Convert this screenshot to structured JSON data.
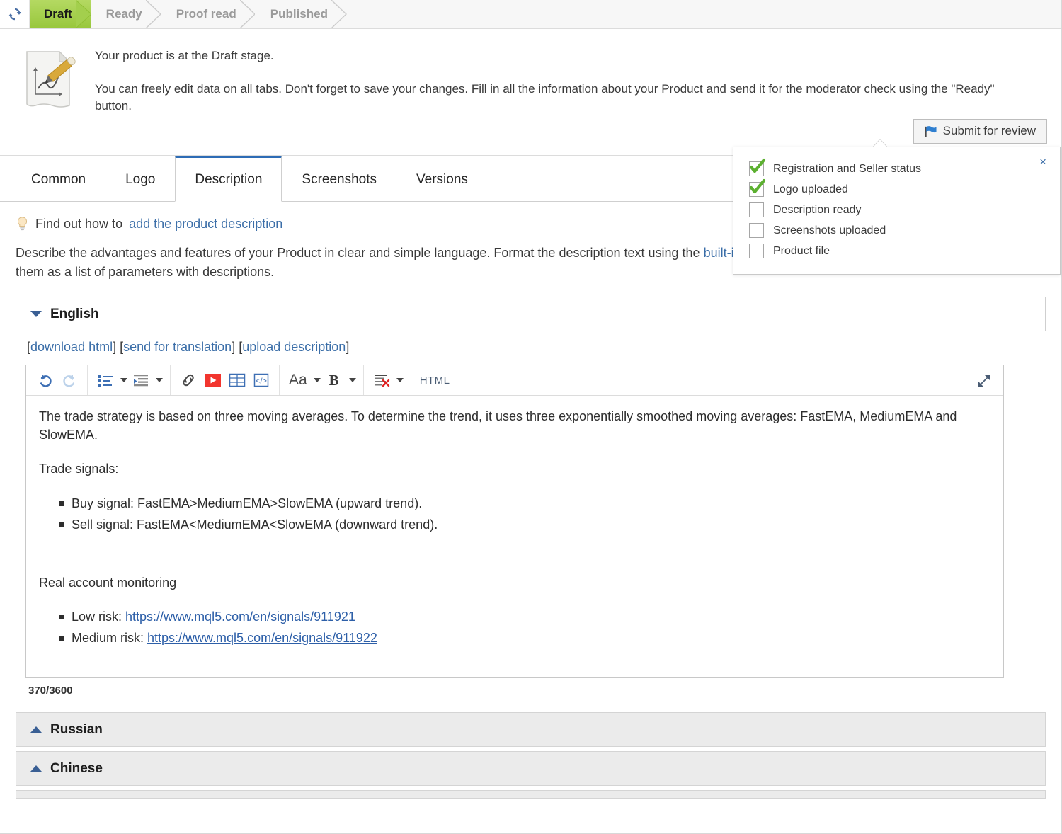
{
  "statusbar": {
    "refresh_icon": "refresh-icon",
    "steps": [
      {
        "label": "Draft",
        "active": true
      },
      {
        "label": "Ready",
        "active": false
      },
      {
        "label": "Proof read",
        "active": false
      },
      {
        "label": "Published",
        "active": false
      }
    ]
  },
  "notice": {
    "icon": "document-pencil-icon",
    "line1": "Your product is at the Draft stage.",
    "line2": "You can freely edit data on all tabs. Don't forget to save your changes. Fill in all the information about your Product and send it for the moderator check using the \"Ready\" button.",
    "submit_label": "Submit for review",
    "submit_icon": "flag-icon"
  },
  "checklist": {
    "close_label": "×",
    "items": [
      {
        "label": "Registration and Seller status",
        "checked": true
      },
      {
        "label": "Logo uploaded",
        "checked": true
      },
      {
        "label": "Description ready",
        "checked": false
      },
      {
        "label": "Screenshots uploaded",
        "checked": false
      },
      {
        "label": "Product file",
        "checked": false
      }
    ]
  },
  "tabs": [
    {
      "label": "Common",
      "active": false
    },
    {
      "label": "Logo",
      "active": false
    },
    {
      "label": "Description",
      "active": true
    },
    {
      "label": "Screenshots",
      "active": false
    },
    {
      "label": "Versions",
      "active": false
    }
  ],
  "content": {
    "hint_icon": "lightbulb-icon",
    "hint_prefix": "Find out how to",
    "hint_link": "add the product description",
    "description_part1": "Describe the advantages and features of your Product in clear and simple language. Format the description text using the ",
    "description_link": "built-in editor",
    "description_part2": ". If your product has inputs, add them as a list of parameters with descriptions."
  },
  "english_section": {
    "title": "English",
    "expanded": true,
    "links": {
      "open1": "[",
      "download": "download html",
      "close1": "] [",
      "translate": "send for translation",
      "close2": "] [",
      "upload": "upload description",
      "close3": "]"
    },
    "counter": "370/3600"
  },
  "toolbar": {
    "undo": "undo-icon",
    "redo": "redo-icon",
    "bullet_list": "bullet-list-icon",
    "indent": "indent-icon",
    "link": "link-icon",
    "video": "video-icon",
    "table": "table-icon",
    "code": "code-icon",
    "font": "Aa",
    "bold": "B",
    "clear_format": "clear-format-icon",
    "html_label": "HTML",
    "expand": "expand-icon"
  },
  "editor_content": {
    "para1": "The trade strategy is based on three moving averages. To determine the trend, it uses three exponentially smoothed moving averages: FastEMA, MediumEMA and SlowEMA.",
    "para2": "Trade signals:",
    "signals": [
      "Buy signal: FastEMA>MediumEMA>SlowEMA (upward trend).",
      "Sell signal: FastEMA<MediumEMA<SlowEMA (downward trend)."
    ],
    "para3": "Real account monitoring",
    "monitoring": [
      {
        "prefix": "Low risk: ",
        "url": "https://www.mql5.com/en/signals/911921"
      },
      {
        "prefix": "Medium risk: ",
        "url": "https://www.mql5.com/en/signals/911922"
      }
    ]
  },
  "other_sections": [
    {
      "title": "Russian",
      "expanded": false
    },
    {
      "title": "Chinese",
      "expanded": false
    }
  ],
  "colors": {
    "accent_blue": "#2d6cb5",
    "link_blue": "#3b6ea8",
    "draft_green": "#a3cf4d",
    "check_green": "#5cb030",
    "video_red": "#f2352e"
  }
}
